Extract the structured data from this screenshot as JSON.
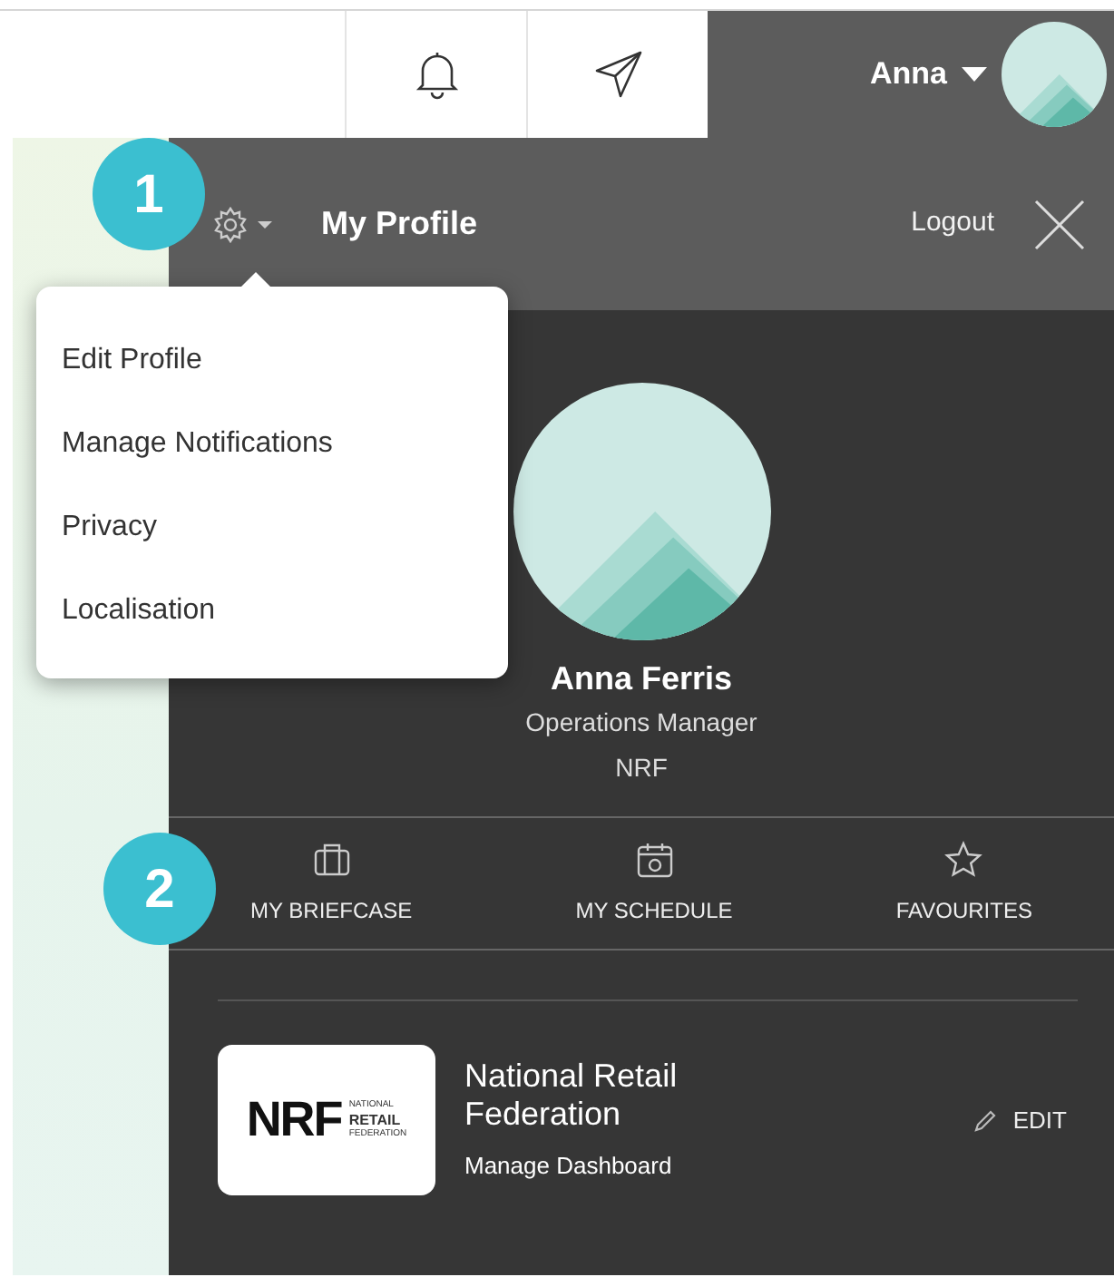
{
  "top_bar": {
    "user_name": "Anna"
  },
  "profile_panel": {
    "title": "My Profile",
    "logout": "Logout"
  },
  "settings_menu": {
    "expanded": true,
    "items": [
      "Edit Profile",
      "Manage Notifications",
      "Privacy",
      "Localisation"
    ]
  },
  "callouts": [
    "1",
    "2"
  ],
  "profile": {
    "name": "Anna Ferris",
    "job_title": "Operations Manager",
    "organisation": "NRF"
  },
  "nav": [
    {
      "kind": "briefcase",
      "label": "MY BRIEFCASE"
    },
    {
      "kind": "calendar",
      "label": "MY SCHEDULE"
    },
    {
      "kind": "star",
      "label": "FAVOURITES"
    }
  ],
  "dashboard": {
    "logo": {
      "mark": "NRF",
      "lines": [
        "NATIONAL",
        "RETAIL",
        "FEDERATION"
      ]
    },
    "name": "National Retail Federation",
    "link": "Manage Dashboard",
    "edit": "EDIT"
  }
}
